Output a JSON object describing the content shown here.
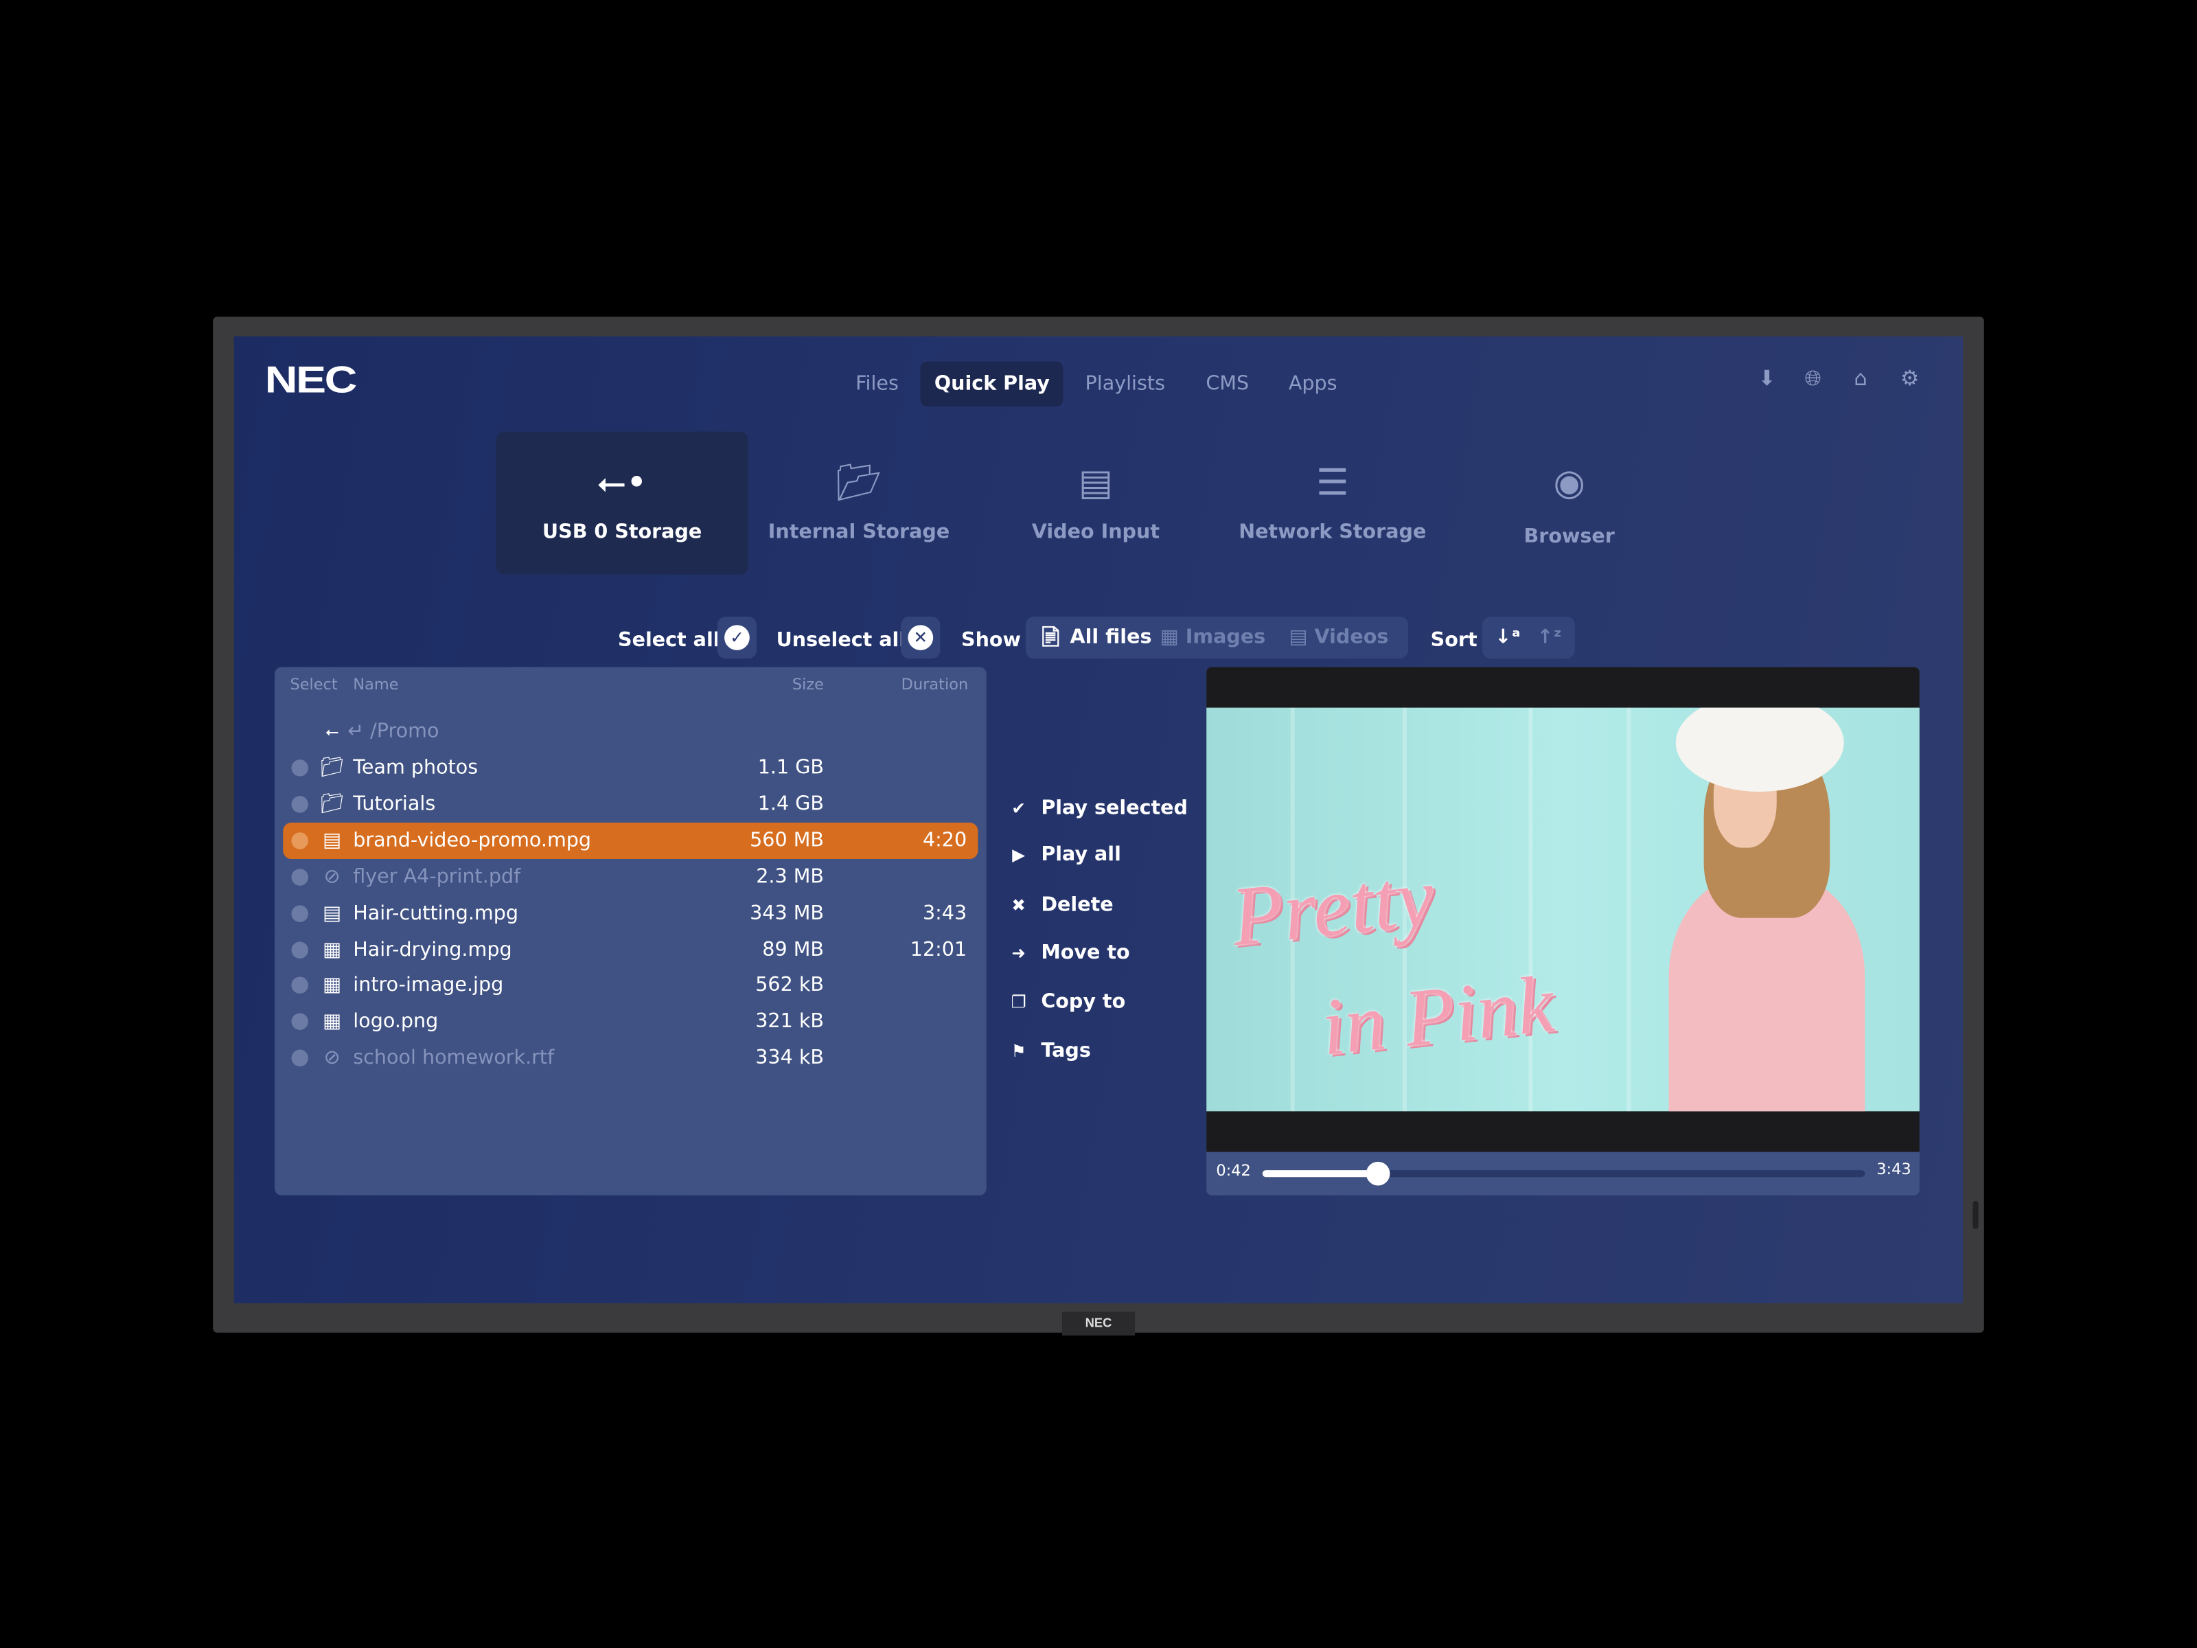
{
  "brand": "NEC",
  "bezel_logo": "NEC",
  "nav": {
    "tabs": [
      {
        "label": "Files"
      },
      {
        "label": "Quick Play",
        "active": true
      },
      {
        "label": "Playlists"
      },
      {
        "label": "CMS"
      },
      {
        "label": "Apps"
      }
    ]
  },
  "top_icons": [
    "download-icon",
    "globe-icon",
    "wifi-icon",
    "gear-icon"
  ],
  "sources": [
    {
      "label": "USB 0 Storage",
      "icon": "usb-icon",
      "active": true
    },
    {
      "label": "Internal Storage",
      "icon": "folder-open-icon"
    },
    {
      "label": "Video Input",
      "icon": "hdmi-icon"
    },
    {
      "label": "Network Storage",
      "icon": "server-icon"
    },
    {
      "label": "Browser",
      "icon": "chrome-icon"
    }
  ],
  "toolbar": {
    "select_all": "Select all",
    "unselect_all": "Unselect all",
    "show": "Show",
    "filters": [
      "All files",
      "Images",
      "Videos"
    ],
    "active_filter": "All files",
    "sort": "Sort"
  },
  "files": {
    "headers": {
      "select": "Select",
      "name": "Name",
      "size": "Size",
      "duration": "Duration"
    },
    "path": "/Promo",
    "rows": [
      {
        "name": "Team photos",
        "size": "1.1 GB",
        "duration": "",
        "type": "folder"
      },
      {
        "name": "Tutorials",
        "size": "1.4 GB",
        "duration": "",
        "type": "folder"
      },
      {
        "name": "brand-video-promo.mpg",
        "size": "560 MB",
        "duration": "4:20",
        "type": "video",
        "selected": true
      },
      {
        "name": "flyer A4-print.pdf",
        "size": "2.3 MB",
        "duration": "",
        "type": "unsupported"
      },
      {
        "name": "Hair-cutting.mpg",
        "size": "343 MB",
        "duration": "3:43",
        "type": "video"
      },
      {
        "name": "Hair-drying.mpg",
        "size": "89 MB",
        "duration": "12:01",
        "type": "image"
      },
      {
        "name": "intro-image.jpg",
        "size": "562 kB",
        "duration": "",
        "type": "image"
      },
      {
        "name": "logo.png",
        "size": "321 kB",
        "duration": "",
        "type": "image"
      },
      {
        "name": "school homework.rtf",
        "size": "334 kB",
        "duration": "",
        "type": "unsupported"
      }
    ]
  },
  "actions": [
    {
      "label": "Play selected",
      "icon": "check-circle-icon"
    },
    {
      "label": "Play all",
      "icon": "play-icon"
    },
    {
      "label": "Delete",
      "icon": "x-circle-icon"
    },
    {
      "label": "Move to",
      "icon": "arrow-circle-icon"
    },
    {
      "label": "Copy to",
      "icon": "copy-icon"
    },
    {
      "label": "Tags",
      "icon": "tags-icon"
    }
  ],
  "player": {
    "current": "0:42",
    "total": "3:43",
    "progress_fraction": 0.19,
    "image_text": [
      "Pretty",
      "in Pink"
    ]
  },
  "colors": {
    "accent": "#d66d1f",
    "background": "#24346b",
    "panel": "#3f5283"
  }
}
